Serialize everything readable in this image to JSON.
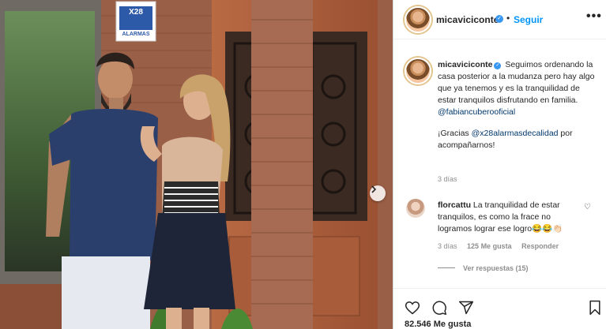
{
  "post": {
    "username": "micaviciconte",
    "follow_label": "Seguir",
    "more_label": "•••",
    "separator": "•"
  },
  "photo": {
    "sign_text": "X28",
    "sign_subtext": "ALARMAS",
    "next_icon": "chevron-right-icon"
  },
  "caption": {
    "username": "micaviciconte",
    "text_1": "Seguimos ordenando la casa posterior a la mudanza pero hay algo que ya tenemos y es la tranquilidad de estar tranquilos disfrutando en familia.",
    "mention_1": "@fabiancuberooficial",
    "text_2": "¡Gracias",
    "mention_2": "@x28alarmasdecalidad",
    "text_3": "por acompañarnos!",
    "time": "3 días"
  },
  "comment": {
    "username": "florcattu",
    "text": "La tranquilidad de estar tranquilos, es como la frace no logramos lograr ese logro😂😂👏🏻",
    "time": "3 días",
    "likes": "125 Me gusta",
    "reply": "Responder",
    "view_replies": "Ver respuestas (15)"
  },
  "footer": {
    "likes": "82.546 Me gusta"
  },
  "colors": {
    "accent": "#0095f6",
    "verified": "#3897f0",
    "text": "#262626",
    "muted": "#8e8e8e",
    "mention": "#00376b"
  }
}
